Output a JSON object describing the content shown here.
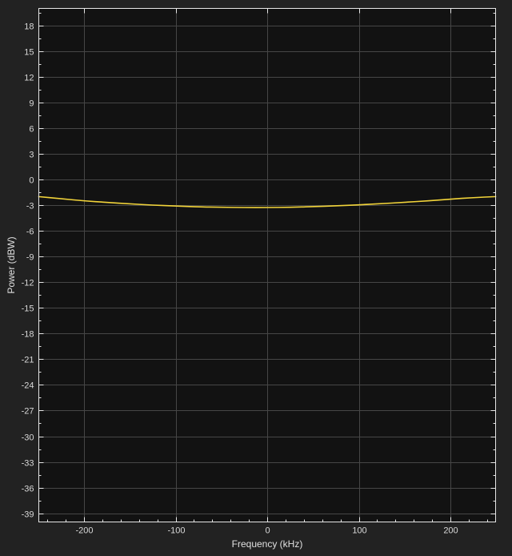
{
  "chart_data": {
    "type": "line",
    "title": "",
    "xlabel": "Frequency (kHz)",
    "ylabel": "Power (dBW)",
    "xlim": [
      -250,
      250
    ],
    "ylim": [
      -40,
      20
    ],
    "xticks": [
      -200,
      -100,
      0,
      100,
      200
    ],
    "yticks": [
      18,
      15,
      12,
      9,
      6,
      3,
      0,
      -3,
      -6,
      -9,
      -12,
      -15,
      -18,
      -21,
      -24,
      -27,
      -30,
      -33,
      -36,
      -39
    ],
    "grid": true,
    "series": [
      {
        "name": "spectrum",
        "color": "#f2d43a",
        "x": [
          -250,
          -225,
          -200,
          -175,
          -150,
          -125,
          -100,
          -75,
          -50,
          -25,
          0,
          25,
          50,
          75,
          100,
          125,
          150,
          175,
          200,
          225,
          250
        ],
        "y": [
          -2.0,
          -2.25,
          -2.5,
          -2.68,
          -2.85,
          -3.0,
          -3.1,
          -3.2,
          -3.25,
          -3.28,
          -3.28,
          -3.25,
          -3.18,
          -3.08,
          -2.97,
          -2.83,
          -2.67,
          -2.5,
          -2.3,
          -2.12,
          -2.0
        ]
      }
    ]
  },
  "colors": {
    "background": "#222222",
    "plot_background": "#121212",
    "grid": "#464646",
    "axis": "#e6e6e6"
  }
}
